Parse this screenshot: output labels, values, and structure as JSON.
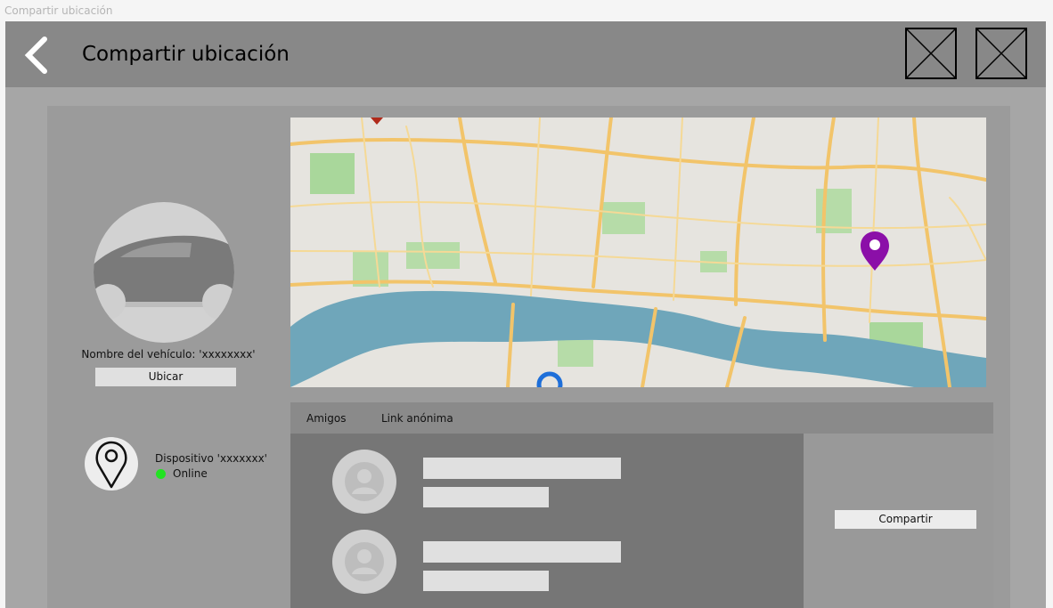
{
  "frame_label": "Compartir ubicación",
  "header": {
    "title": "Compartir ubicación",
    "back_icon": "chevron-left-icon",
    "image_placeholders": [
      "image-placeholder-icon",
      "image-placeholder-icon"
    ]
  },
  "vehicle": {
    "name": "Nombre del vehículo: 'xxxxxxxx'",
    "locate_button": "Ubicar",
    "icon": "car-icon"
  },
  "device": {
    "name": "Dispositivo 'xxxxxxx'",
    "status": "Online",
    "status_color": "#22e322",
    "icon": "location-pin-icon"
  },
  "map": {
    "markers": [
      {
        "name": "destination-marker",
        "color": "#8b0fa8"
      },
      {
        "name": "user-location-marker",
        "color": "#1e6fd9"
      },
      {
        "name": "top-marker",
        "color": "#b02a1a"
      }
    ]
  },
  "share": {
    "tabs": [
      "Amigos",
      "Link anónima"
    ],
    "friends_count": 2,
    "share_button": "Compartir"
  }
}
